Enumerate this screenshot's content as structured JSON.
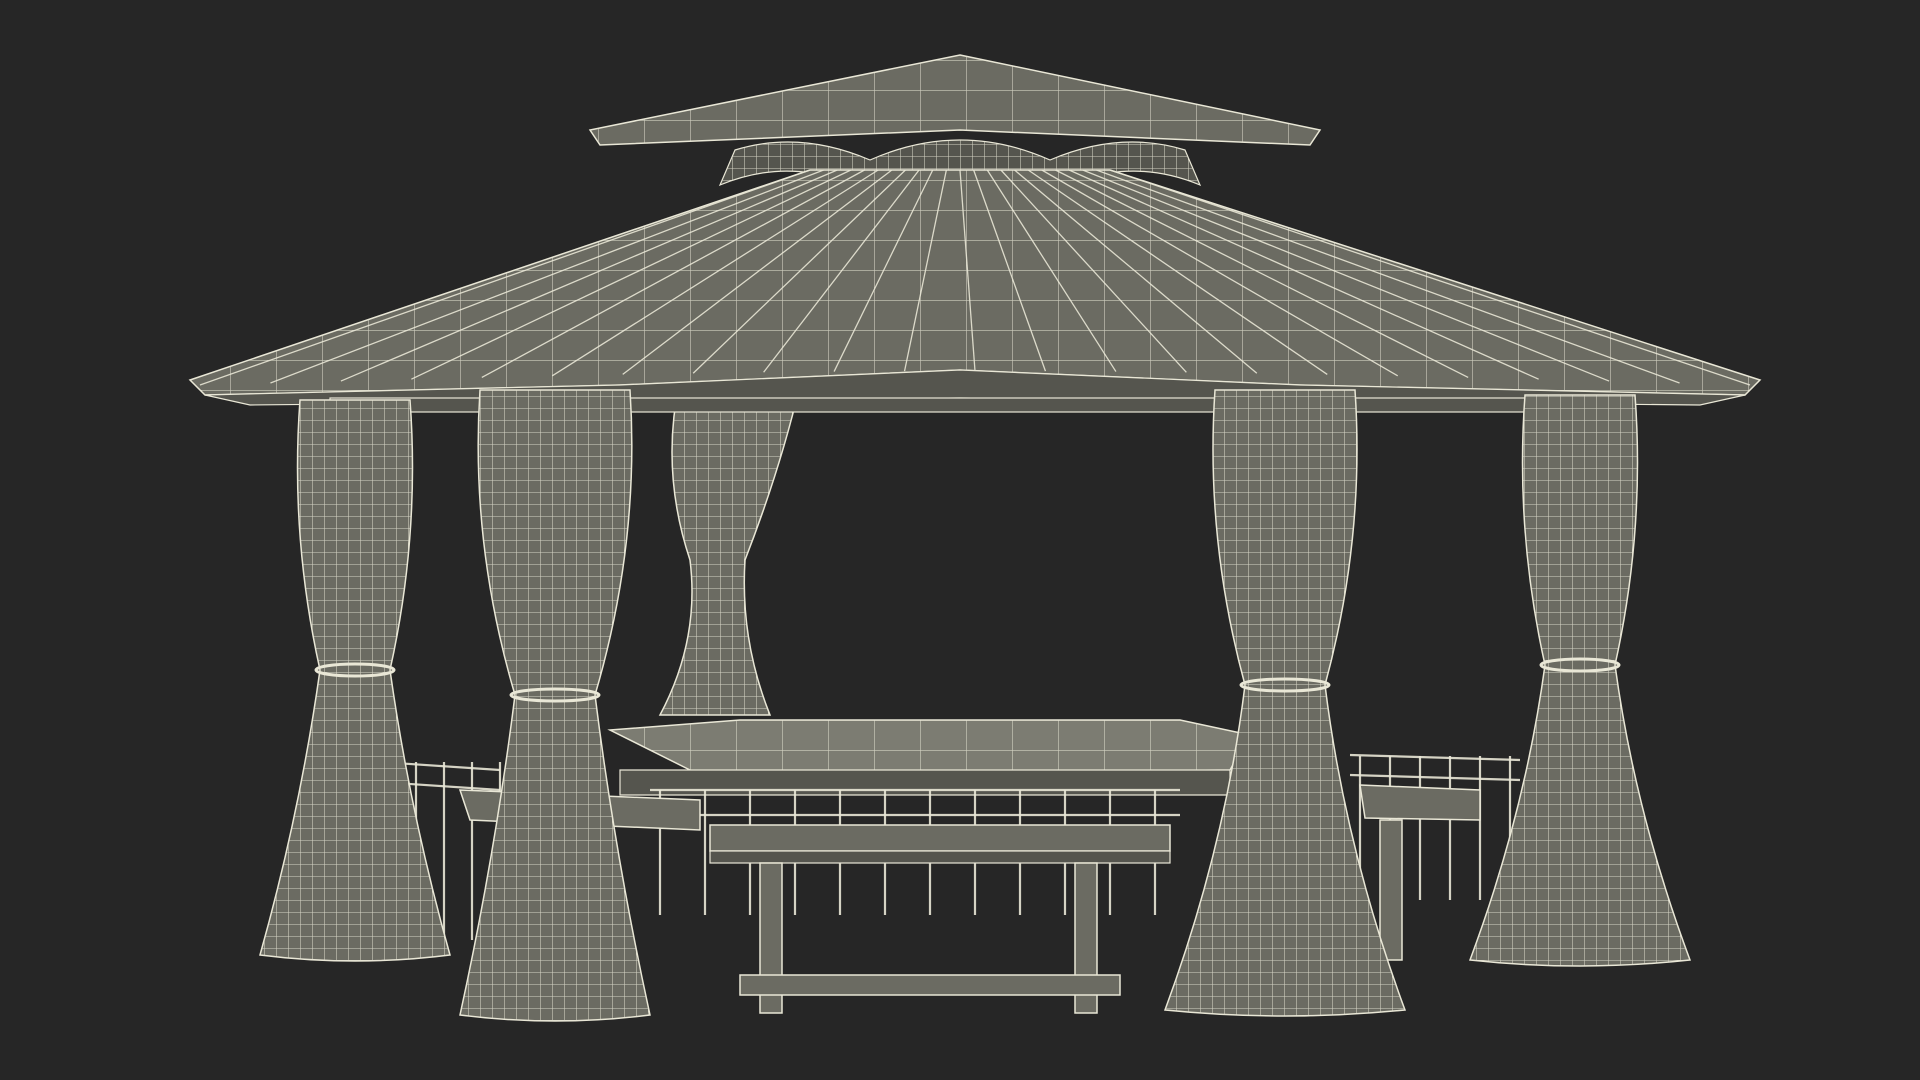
{
  "scene": {
    "subject": "gazebo-wireframe-render",
    "colors": {
      "background": "#262626",
      "surface": "#6b6b62",
      "surface_dark": "#55554e",
      "surface_light": "#7c7c72",
      "wire": "#e9e7d6",
      "edge": "#3a3a35"
    }
  }
}
